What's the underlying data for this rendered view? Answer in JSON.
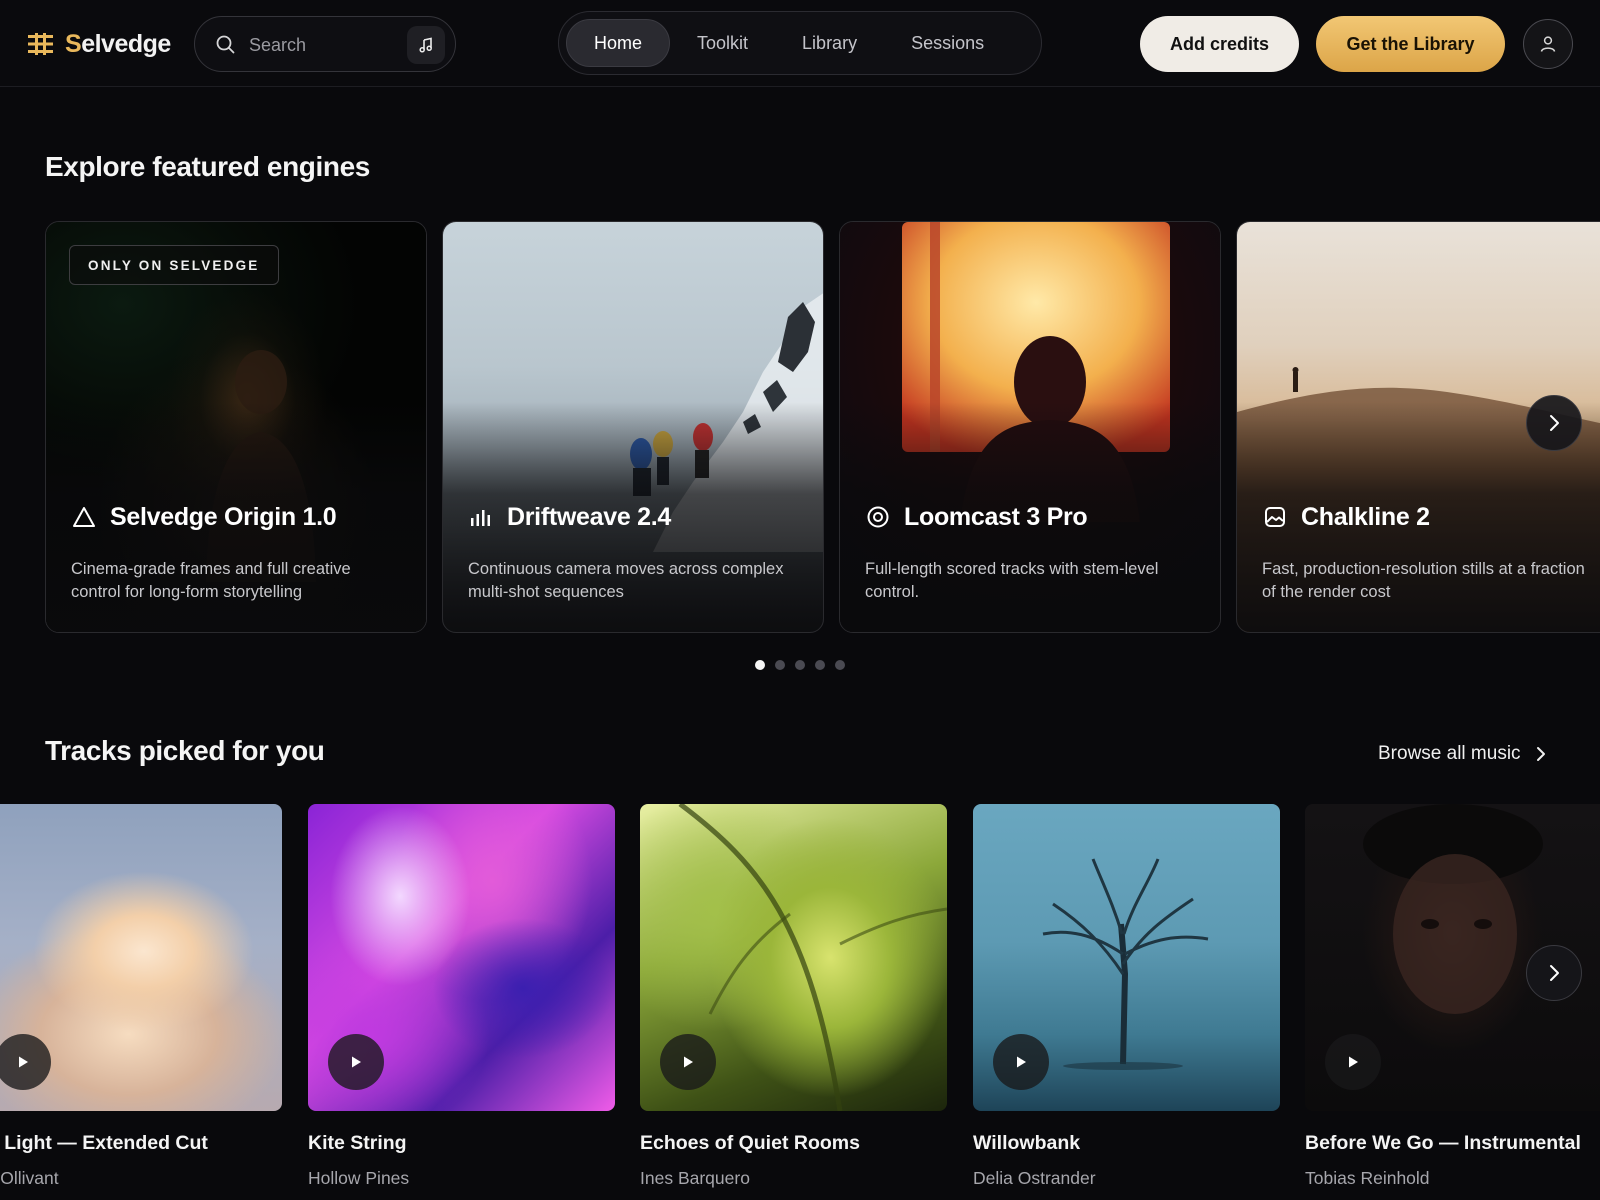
{
  "header": {
    "logo_first": "S",
    "logo_rest": "elvedge",
    "search": {
      "placeholder": "Search"
    },
    "nav": [
      {
        "label": "Home",
        "active": true
      },
      {
        "label": "Toolkit",
        "active": false
      },
      {
        "label": "Library",
        "active": false
      },
      {
        "label": "Sessions",
        "active": false
      }
    ],
    "add_credits": "Add credits",
    "get_library": "Get the Library"
  },
  "engines": {
    "title": "Explore featured engines",
    "badge": "ONLY ON SELVEDGE",
    "items": [
      {
        "name": "Selvedge Origin 1.0",
        "icon": "triangle-icon",
        "desc": "Cinema-grade frames and full creative control for long-form storytelling"
      },
      {
        "name": "Driftweave 2.4",
        "icon": "bars-icon",
        "desc": "Continuous camera moves across complex multi-shot sequences"
      },
      {
        "name": "Loomcast 3 Pro",
        "icon": "target-icon",
        "desc": "Full-length scored tracks with stem-level control."
      },
      {
        "name": "Chalkline 2",
        "icon": "image-icon",
        "desc": "Fast, production-resolution stills at a fraction of the render cost"
      }
    ],
    "pagination": {
      "total": 5,
      "active": 1
    }
  },
  "tracks": {
    "title": "Tracks picked for you",
    "browse": "Browse all music",
    "items": [
      {
        "title": "ng Light — Extended Cut",
        "artist": "rta Ollivant"
      },
      {
        "title": "Kite String",
        "artist": "Hollow Pines"
      },
      {
        "title": "Echoes of Quiet Rooms",
        "artist": "Ines Barquero"
      },
      {
        "title": "Willowbank",
        "artist": "Delia Ostrander"
      },
      {
        "title": "Before We Go — Instrumental",
        "artist": "Tobias Reinhold"
      }
    ]
  },
  "colors": {
    "accent": "#e9b85c",
    "background": "#09090c"
  }
}
